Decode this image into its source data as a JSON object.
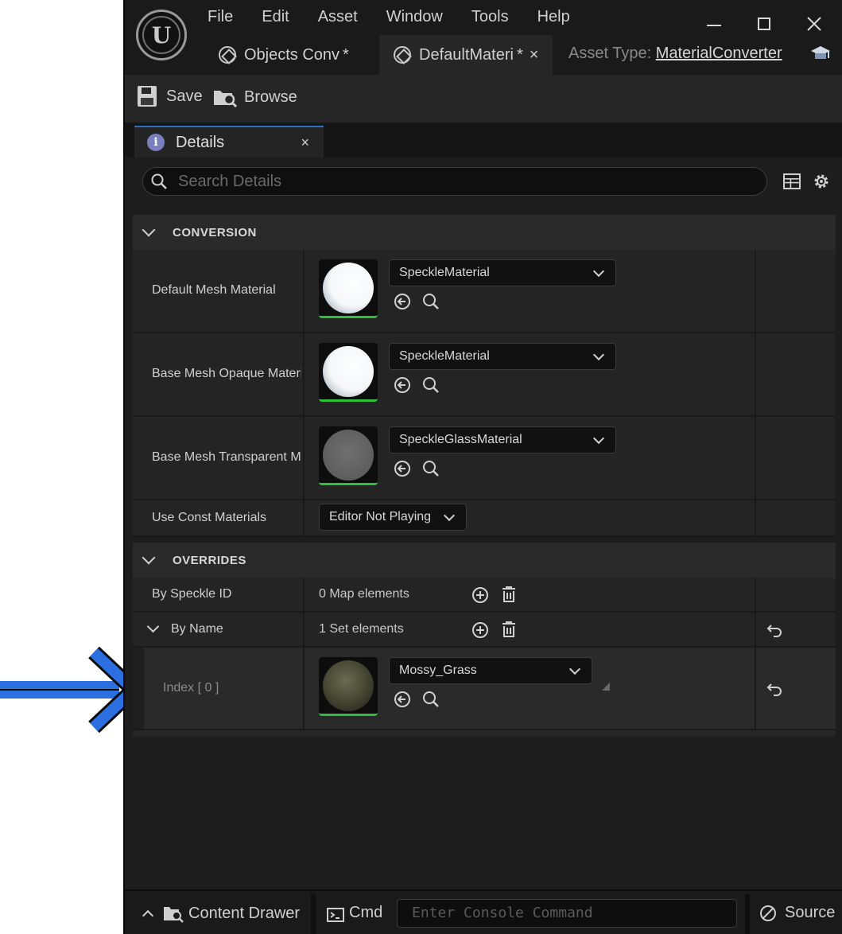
{
  "menu": [
    "File",
    "Edit",
    "Asset",
    "Window",
    "Tools",
    "Help"
  ],
  "tabs": [
    {
      "label": "Objects Conv *"
    },
    {
      "label": "DefaultMateri *",
      "close": "×"
    }
  ],
  "asset_type": {
    "label": "Asset Type:",
    "value": "MaterialConverter"
  },
  "toolbar": {
    "save_label": "Save",
    "browse_label": "Browse"
  },
  "details_tab": {
    "label": "Details",
    "close": "×"
  },
  "search": {
    "placeholder": "Search Details"
  },
  "sections": {
    "conversion": "CONVERSION",
    "overrides": "OVERRIDES"
  },
  "conversion_rows": [
    {
      "name": "Default Mesh Material",
      "value": "SpeckleMaterial"
    },
    {
      "name": "Base Mesh Opaque Materi",
      "value": "SpeckleMaterial"
    },
    {
      "name": "Base Mesh Transparent M",
      "value": "SpeckleGlassMaterial"
    }
  ],
  "const_materials": {
    "name": "Use Const Materials",
    "value": "Editor Not Playing"
  },
  "overrides": {
    "by_speckle_id": {
      "name": "By Speckle ID",
      "value": "0 Map elements"
    },
    "by_name": {
      "name": "By Name",
      "value": "1 Set elements"
    },
    "index0": {
      "name": "Index [ 0 ]",
      "value": "Mossy_Grass"
    }
  },
  "statusbar": {
    "content_drawer": "Content Drawer",
    "cmd": "Cmd",
    "console_placeholder": "Enter Console Command",
    "source": "Source"
  }
}
